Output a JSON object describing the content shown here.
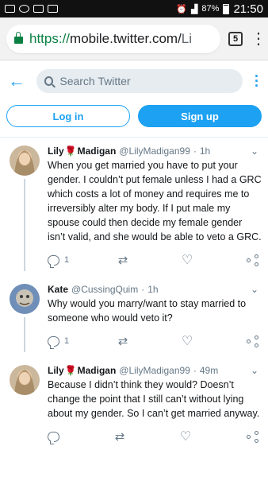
{
  "status_bar": {
    "battery": "87%",
    "time": "21:50"
  },
  "browser": {
    "url_scheme": "https://",
    "url_host": "mobile.twitter.com/",
    "url_rest": "Li",
    "tab_count": "5",
    "menu_icon": "kebab-menu-icon"
  },
  "header": {
    "search_placeholder": "Search Twitter"
  },
  "auth": {
    "login_label": "Log in",
    "signup_label": "Sign up"
  },
  "colors": {
    "accent": "#1da1f2",
    "secure": "#0b8043",
    "muted": "#657786"
  },
  "tweets": [
    {
      "name": "Lily",
      "emoji": "🌹",
      "name_suffix": "Madigan",
      "handle": "@LilyMadigan99",
      "sep": "·",
      "time": "1h",
      "text": "When you get married you have to put your gender. I couldn’t put female unless I had a GRC which costs a lot of money and requires me to irreversibly alter my body. If I put male my spouse could then decide my female gender isn’t valid, and she would be able to veto a GRC.",
      "replies": "1",
      "retweets": "",
      "likes": ""
    },
    {
      "name": "Kate",
      "emoji": "",
      "name_suffix": "",
      "handle": "@CussingQuim",
      "sep": "·",
      "time": "1h",
      "text": "Why would you marry/want to stay married to someone who would veto it?",
      "replies": "1",
      "retweets": "",
      "likes": ""
    },
    {
      "name": "Lily",
      "emoji": "🌹",
      "name_suffix": "Madigan",
      "handle": "@LilyMadigan99",
      "sep": "·",
      "time": "49m",
      "text": "Because I didn’t think they would? Doesn’t change the point that I still can’t without lying about my gender. So I can’t get married anyway.",
      "replies": "",
      "retweets": "",
      "likes": ""
    }
  ]
}
